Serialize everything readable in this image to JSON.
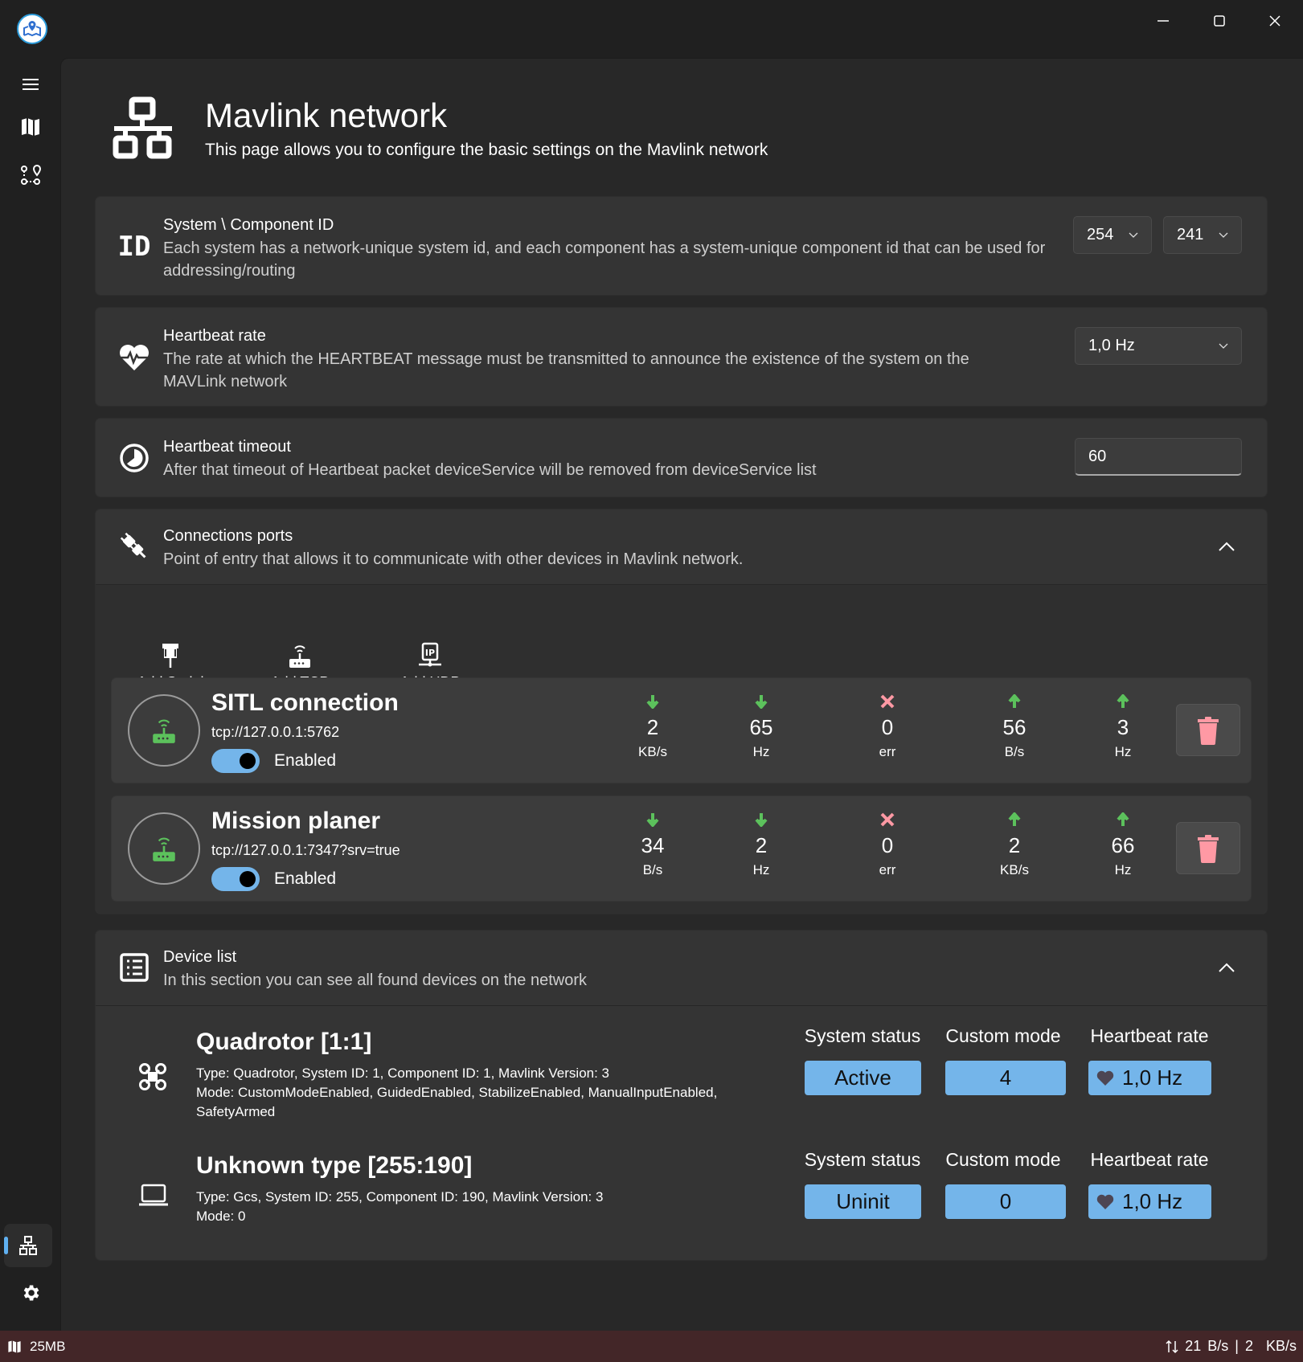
{
  "window": {
    "minimize_icon": "minimize-icon",
    "maximize_icon": "maximize-icon",
    "close_icon": "close-icon"
  },
  "sidebar": {
    "logo": "app-logo",
    "items": [
      {
        "name": "menu",
        "icon": "hamburger-icon"
      },
      {
        "name": "map",
        "icon": "map-icon"
      },
      {
        "name": "route",
        "icon": "route-icon"
      }
    ],
    "bottom_items": [
      {
        "name": "network",
        "icon": "network-icon",
        "active": true
      },
      {
        "name": "settings",
        "icon": "gear-icon"
      }
    ]
  },
  "header": {
    "title": "Mavlink network",
    "subtitle": "This page allows you to configure the basic settings on the Mavlink network"
  },
  "settings": {
    "system_id": {
      "icon_text": "ID",
      "title": "System \\ Component ID",
      "description": "Each system has a network-unique system id, and each component has a system-unique component id that can be used for addressing/routing",
      "system_value": "254",
      "component_value": "241"
    },
    "heartbeat_rate": {
      "title": "Heartbeat rate",
      "description": "The rate at which the HEARTBEAT message must be transmitted to announce the existence of the system on the MAVLink network",
      "value": "1,0 Hz"
    },
    "heartbeat_timeout": {
      "title": "Heartbeat timeout",
      "description": "After that timeout of Heartbeat packet deviceService will be removed from deviceService list",
      "value": "60"
    }
  },
  "connections": {
    "title": "Connections ports",
    "description": "Point of entry that allows it to communicate with other devices in Mavlink network.",
    "add_buttons": [
      {
        "label": "Add Serial",
        "icon": "serial-port-icon"
      },
      {
        "label": "Add TCP",
        "icon": "router-icon"
      },
      {
        "label": "Add UDP",
        "icon": "ip-network-icon"
      }
    ],
    "items": [
      {
        "name": "SITL connection",
        "url": "tcp://127.0.0.1:5762",
        "enabled": true,
        "enabled_label": "Enabled",
        "stats": [
          {
            "dir": "down",
            "value": "2",
            "unit": "KB/s"
          },
          {
            "dir": "down",
            "value": "65",
            "unit": "Hz"
          },
          {
            "dir": "err",
            "value": "0",
            "unit": "err"
          },
          {
            "dir": "up",
            "value": "56",
            "unit": "B/s"
          },
          {
            "dir": "up",
            "value": "3",
            "unit": "Hz"
          }
        ]
      },
      {
        "name": "Mission planer",
        "url": "tcp://127.0.0.1:7347?srv=true",
        "enabled": true,
        "enabled_label": "Enabled",
        "stats": [
          {
            "dir": "down",
            "value": "34",
            "unit": "B/s"
          },
          {
            "dir": "down",
            "value": "2",
            "unit": "Hz"
          },
          {
            "dir": "err",
            "value": "0",
            "unit": "err"
          },
          {
            "dir": "up",
            "value": "2",
            "unit": "KB/s"
          },
          {
            "dir": "up",
            "value": "66",
            "unit": "Hz"
          }
        ]
      }
    ]
  },
  "devices": {
    "title": "Device list",
    "description": "In this section you can see all found devices on the network",
    "labels": {
      "system_status": "System status",
      "custom_mode": "Custom mode",
      "heartbeat_rate": "Heartbeat rate"
    },
    "items": [
      {
        "icon": "quadrotor-icon",
        "name": "Quadrotor [1:1]",
        "info": "Type: Quadrotor, System ID: 1, Component ID: 1, Mavlink Version: 3",
        "mode_line1": "Mode: CustomModeEnabled, GuidedEnabled, StabilizeEnabled, ManualInputEnabled,",
        "mode_line2": "SafetyArmed",
        "system_status": "Active",
        "custom_mode": "4",
        "heartbeat": "1,0 Hz"
      },
      {
        "icon": "laptop-icon",
        "name": "Unknown type [255:190]",
        "info": "Type: Gcs, System ID: 255, Component ID: 190, Mavlink Version: 3",
        "mode_line1": "Mode: 0",
        "mode_line2": "",
        "system_status": "Uninit",
        "custom_mode": "0",
        "heartbeat": "1,0 Hz"
      }
    ]
  },
  "statusbar": {
    "map_cache": "25MB",
    "rx_value": "21",
    "rx_unit": "B/s",
    "separator": "|",
    "tx_value": "2",
    "tx_unit": "KB/s"
  },
  "colors": {
    "accent": "#74b5ea",
    "success": "#5cc15c",
    "danger": "#ff99a4",
    "statusbar": "#432628"
  }
}
